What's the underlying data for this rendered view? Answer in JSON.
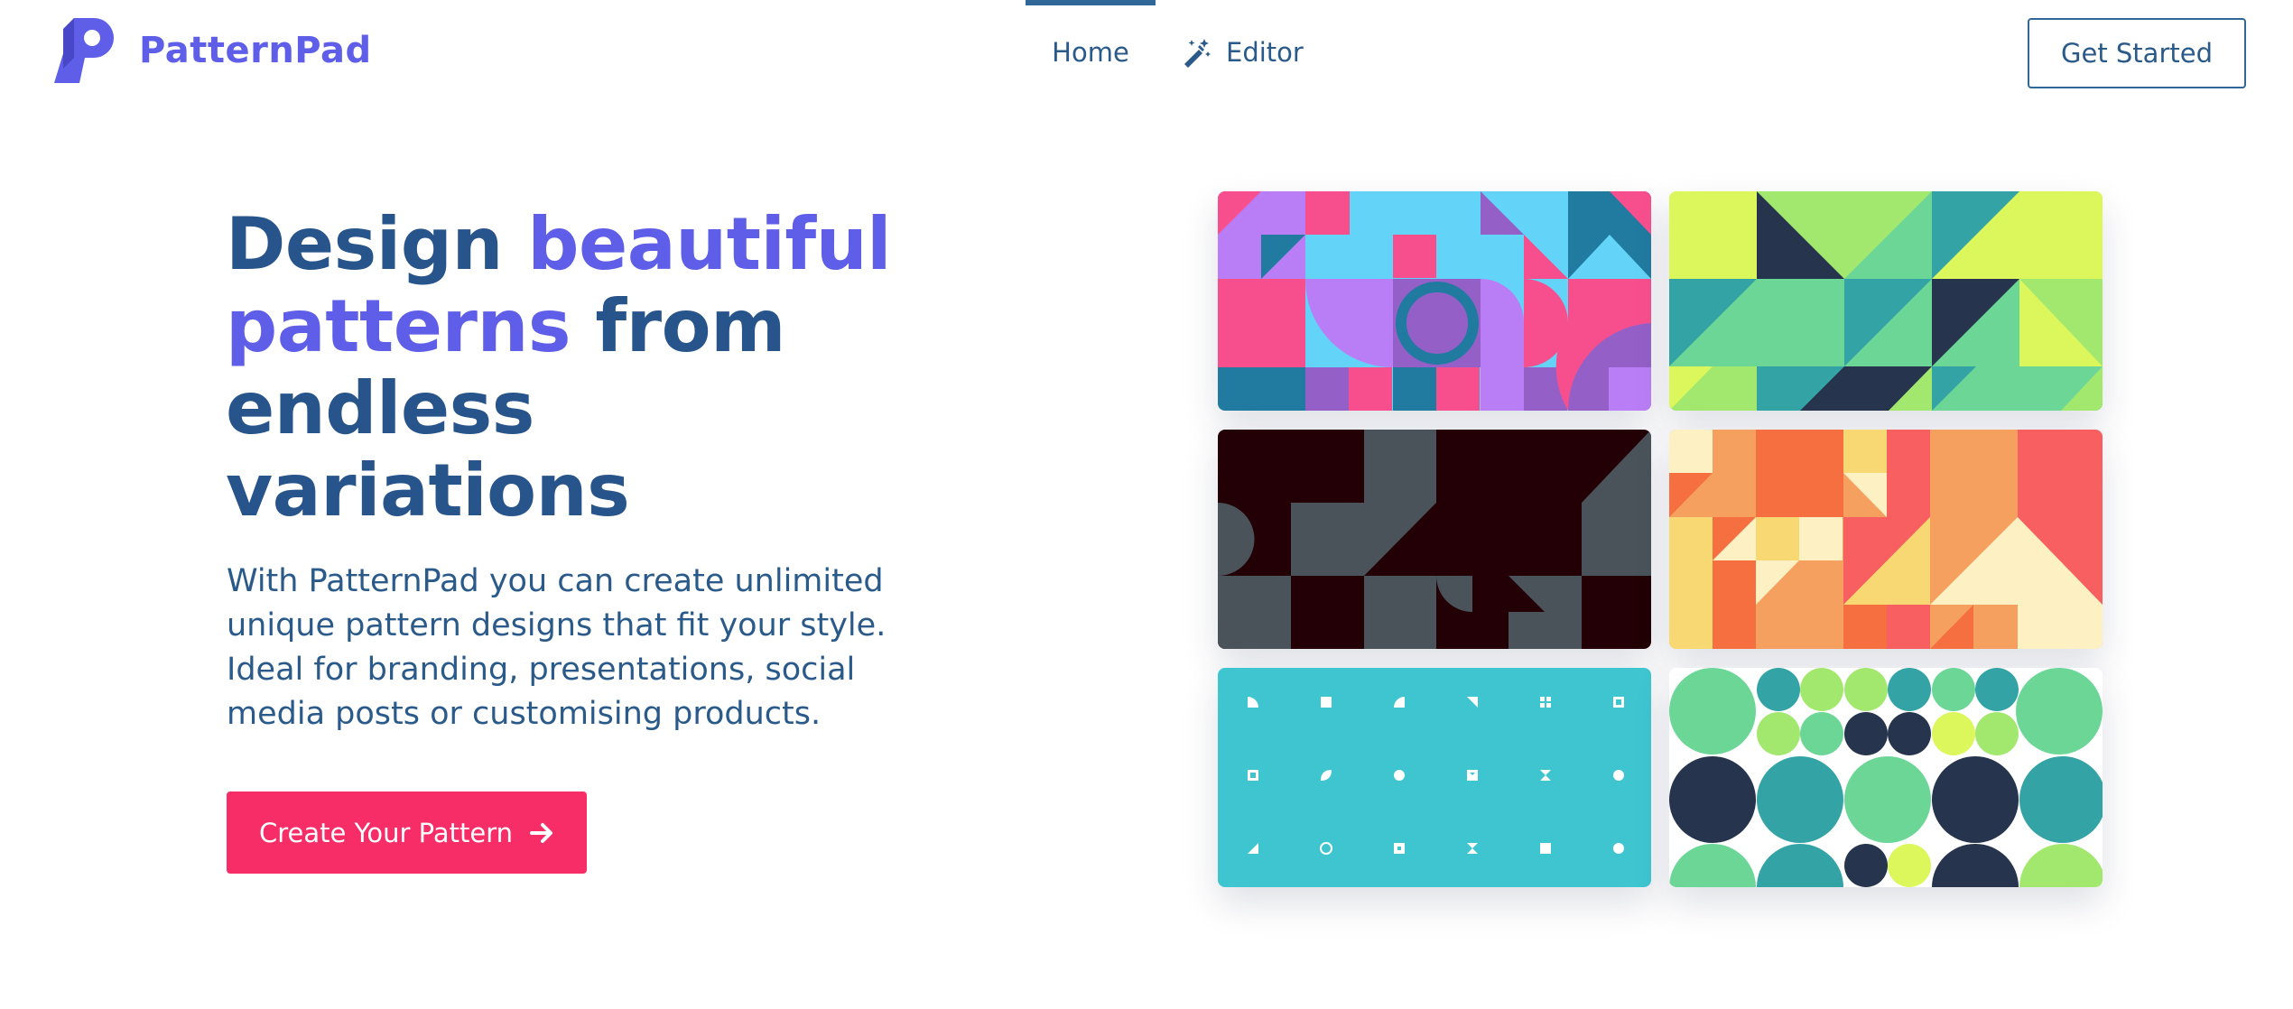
{
  "brand": {
    "name": "PatternPad",
    "color": "#5e5ee8"
  },
  "nav": {
    "items": [
      {
        "label": "Home",
        "active": true
      },
      {
        "label": "Editor",
        "icon": "magic-wand-icon"
      }
    ],
    "get_started_label": "Get Started"
  },
  "hero": {
    "title_part1": "Design ",
    "title_accent": "beautiful patterns",
    "title_part2": " from endless variations",
    "description": "With PatternPad you can create unlimited unique pattern designs that fit your style. Ideal for branding, presentations, social media posts or customising products.",
    "cta_label": "Create Your Pattern",
    "cta_icon": "arrow-right-icon",
    "cta_color": "#f72d68"
  },
  "gallery": {
    "cards": [
      {
        "name": "pink-blue-purple-geometric",
        "colors": [
          "#f74f8e",
          "#63d3f7",
          "#b97ef5",
          "#9460c8",
          "#217aa0"
        ]
      },
      {
        "name": "green-teal-triangles",
        "colors": [
          "#dcf75c",
          "#a3e86e",
          "#6cd697",
          "#34a3a5",
          "#26354d"
        ]
      },
      {
        "name": "dark-maroon-gray",
        "colors": [
          "#220005",
          "#4a525a"
        ]
      },
      {
        "name": "warm-orange-red",
        "colors": [
          "#f56f40",
          "#f5a05f",
          "#f85f60",
          "#f7d872",
          "#fdf0c3"
        ]
      },
      {
        "name": "cyan-small-shapes",
        "colors": [
          "#3ec5d0",
          "#ffffff"
        ]
      },
      {
        "name": "green-navy-circles",
        "colors": [
          "#6cd697",
          "#34a3a5",
          "#26354d",
          "#a3e86e",
          "#dcf75c"
        ]
      }
    ]
  }
}
